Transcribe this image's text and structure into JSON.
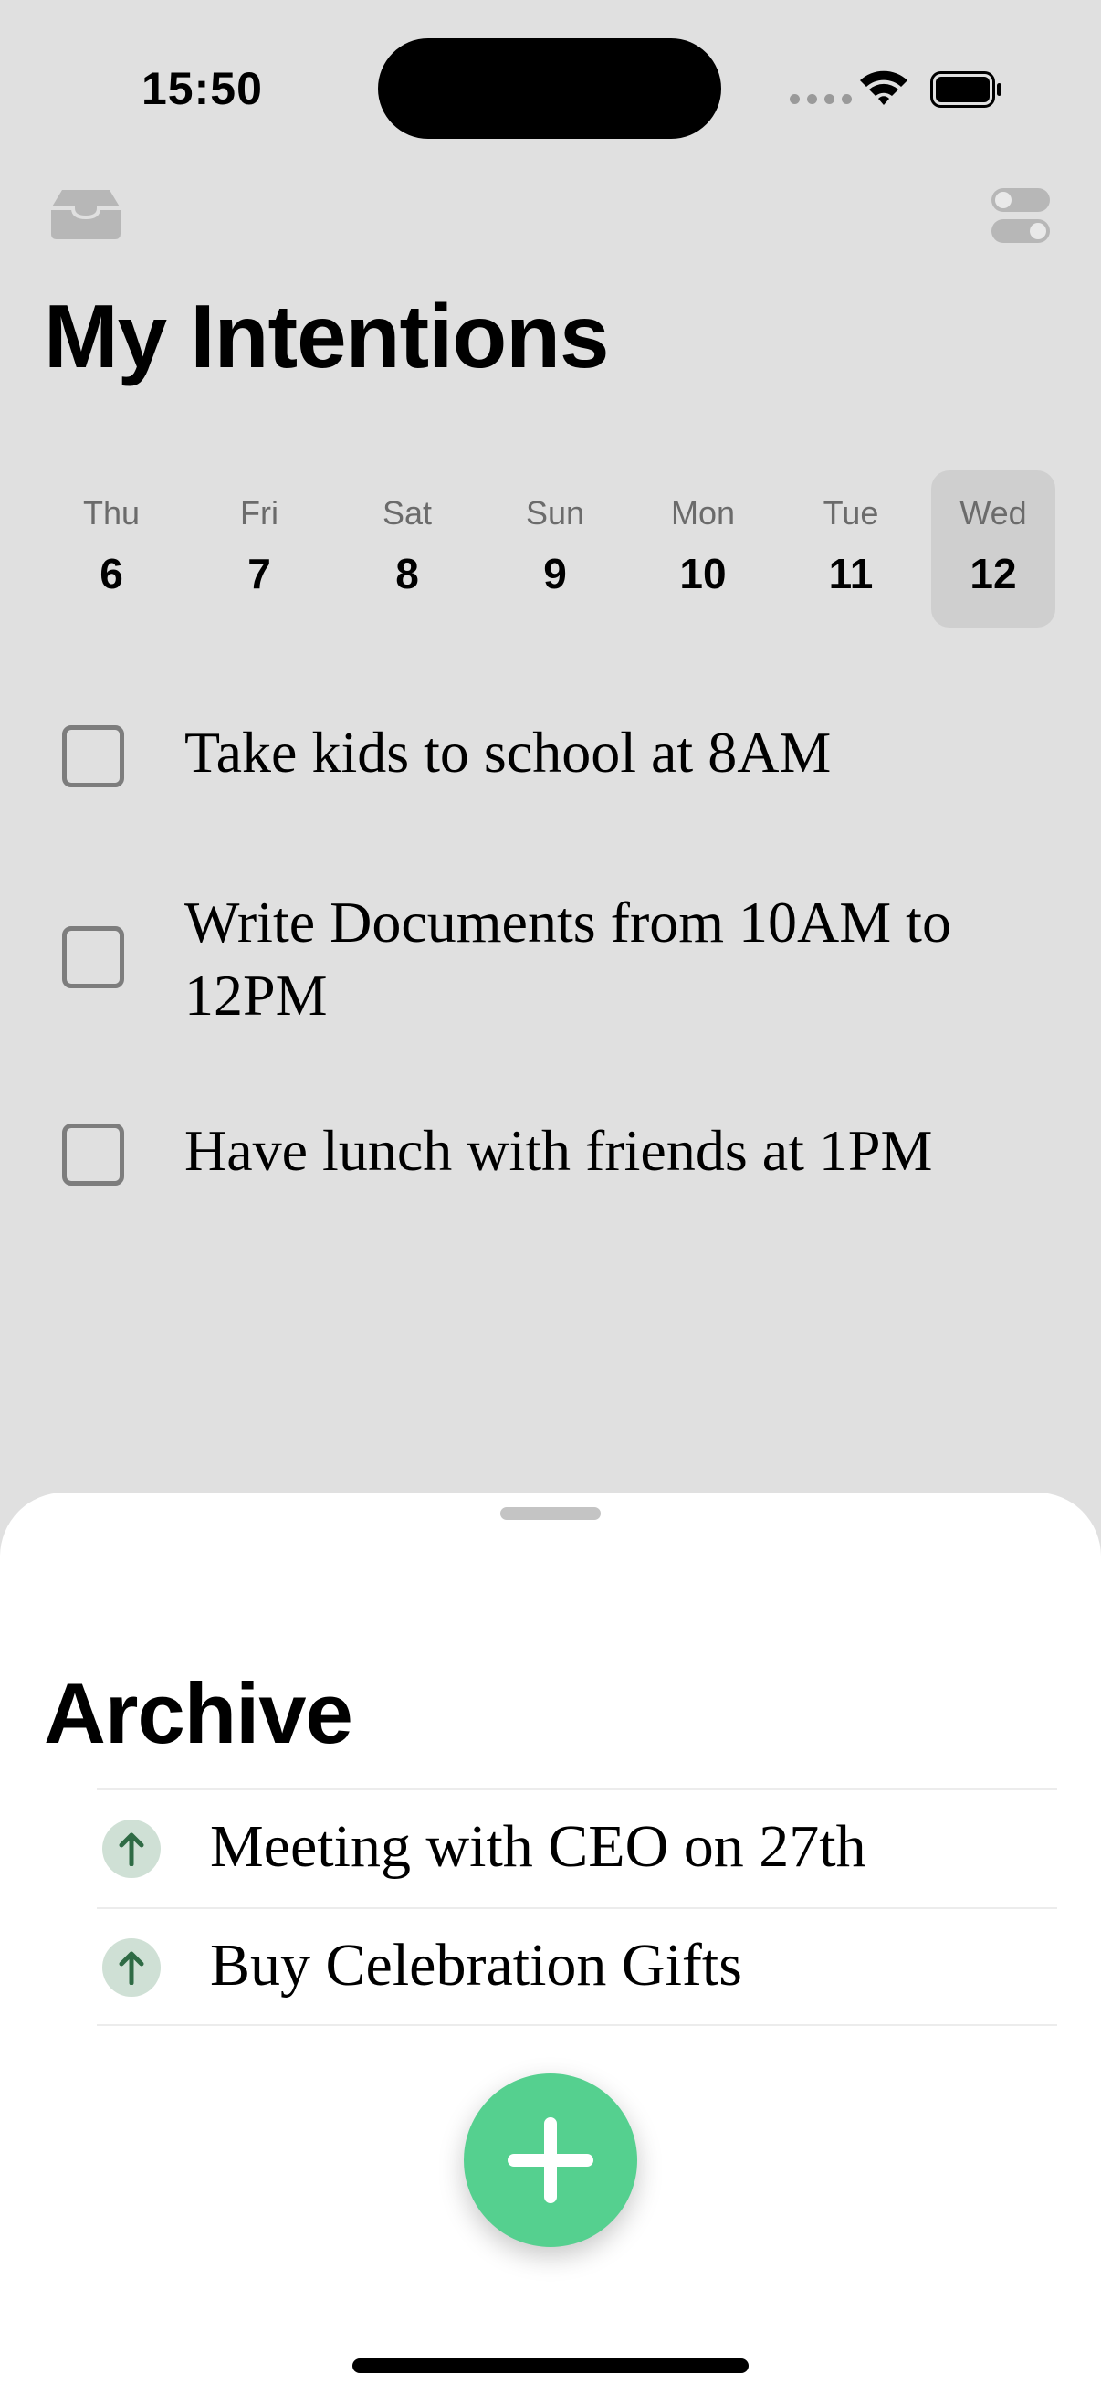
{
  "status_bar": {
    "time": "15:50"
  },
  "header": {
    "title": "My Intentions"
  },
  "week": {
    "days": [
      {
        "name": "Thu",
        "num": "6"
      },
      {
        "name": "Fri",
        "num": "7"
      },
      {
        "name": "Sat",
        "num": "8"
      },
      {
        "name": "Sun",
        "num": "9"
      },
      {
        "name": "Mon",
        "num": "10"
      },
      {
        "name": "Tue",
        "num": "11"
      },
      {
        "name": "Wed",
        "num": "12"
      }
    ],
    "selected": "Wed 12"
  },
  "tasks": [
    {
      "text": "Take kids to school at 8AM",
      "done": false
    },
    {
      "text": "Write Documents from 10AM to 12PM",
      "done": false
    },
    {
      "text": "Have lunch with friends at 1PM",
      "done": false
    }
  ],
  "archive": {
    "title": "Archive",
    "items": [
      {
        "text": "Meeting with CEO on 27th",
        "icon": "arrow-up-icon"
      },
      {
        "text": "Buy Celebration Gifts",
        "icon": "arrow-up-icon"
      }
    ]
  },
  "icons": {
    "top_left": "inbox-tray-icon",
    "top_right": "toggle-settings-icon",
    "fab": "plus-icon"
  },
  "colors": {
    "background": "#e0e0e0",
    "selected_day": "#cfcfcf",
    "fab": "#55d08f",
    "restore_icon_bg": "#cfe0d5",
    "restore_arrow": "#2f6b45"
  }
}
